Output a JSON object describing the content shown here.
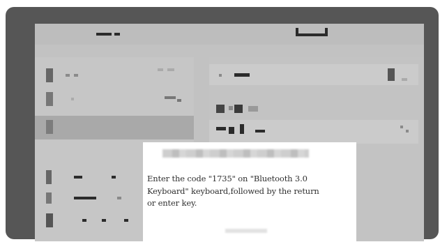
{
  "dialog": {
    "title": "",
    "message": "Enter the code \"1735\" on \"Bluetooth 3.0\nKeyboard\" keyboard,followed by the return\nor enter key.",
    "button_label": ""
  },
  "colors": {
    "bezel": "#565656",
    "screen": "#c2c2c2",
    "dialog_bg": "#ffffff",
    "selected_row": "#a9a9a9"
  }
}
